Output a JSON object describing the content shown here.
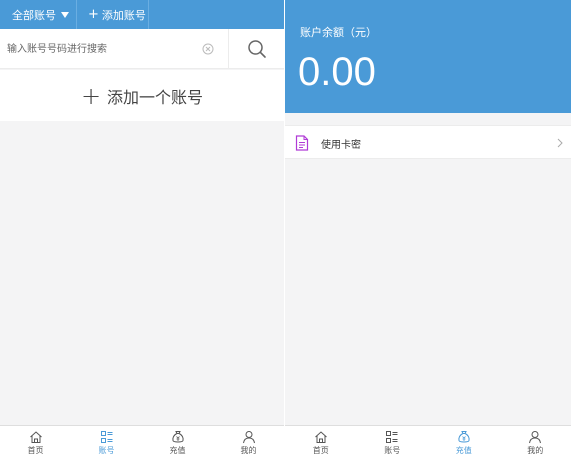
{
  "colors": {
    "accent": "#4a9ad7",
    "icon_gray": "#555555",
    "doc_icon": "#b03bd6"
  },
  "left": {
    "topbar": {
      "all_accounts": "全部账号",
      "add_account": "添加账号"
    },
    "search": {
      "placeholder": "输入账号号码进行搜索"
    },
    "add_button": {
      "label": "添加一个账号"
    }
  },
  "right": {
    "balance": {
      "label": "账户余额（元）",
      "value": "0.00"
    },
    "menu": [
      {
        "label": "使用卡密",
        "icon": "document-icon"
      }
    ]
  },
  "nav": {
    "left": [
      {
        "label": "首页",
        "icon": "home-icon",
        "active": false
      },
      {
        "label": "账号",
        "icon": "list-icon",
        "active": true
      },
      {
        "label": "充值",
        "icon": "money-bag-icon",
        "active": false
      },
      {
        "label": "我的",
        "icon": "user-icon",
        "active": false
      }
    ],
    "right": [
      {
        "label": "首页",
        "icon": "home-icon",
        "active": false
      },
      {
        "label": "账号",
        "icon": "list-icon",
        "active": false
      },
      {
        "label": "充值",
        "icon": "money-bag-icon",
        "active": true
      },
      {
        "label": "我的",
        "icon": "user-icon",
        "active": false
      }
    ]
  }
}
